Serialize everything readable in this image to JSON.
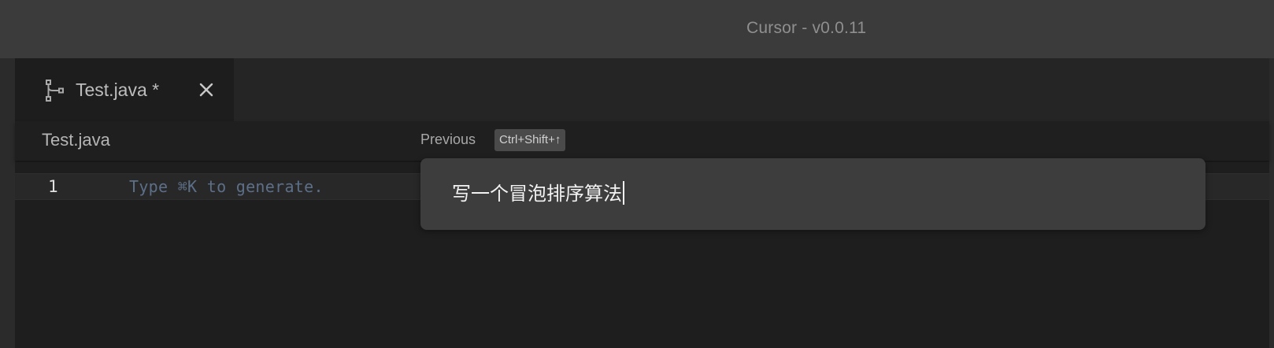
{
  "window": {
    "title": "Cursor - v0.0.11"
  },
  "tabs": [
    {
      "label": "Test.java *",
      "icon": "source-control-icon",
      "close_icon": "close-icon"
    }
  ],
  "breadcrumb": {
    "file": "Test.java"
  },
  "history": {
    "previous_label": "Previous",
    "shortcut": "Ctrl+Shift+↑"
  },
  "editor": {
    "line_number": "1",
    "placeholder": "Type ⌘K to generate."
  },
  "prompt": {
    "value": "写一个冒泡排序算法"
  },
  "colors": {
    "titlebar": "#3b3b3b",
    "editor_background": "#1e1e1e",
    "placeholder_text": "#5d6f88",
    "prompt_background": "#3d3d3d"
  }
}
